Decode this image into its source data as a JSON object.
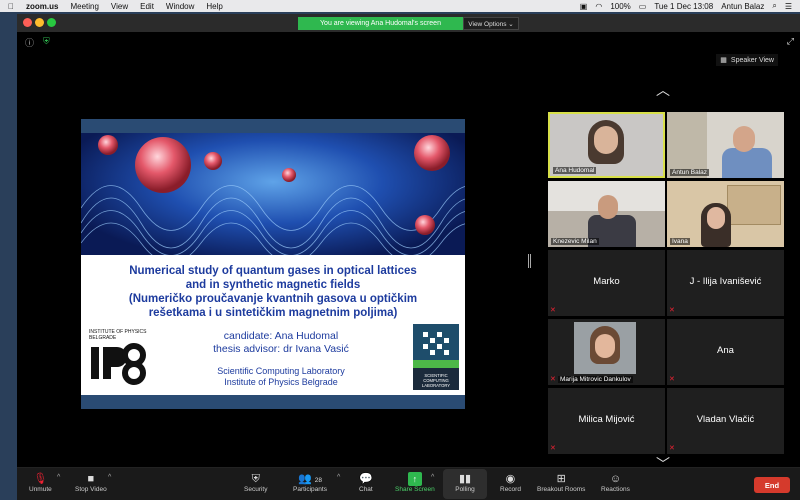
{
  "menubar": {
    "app": "zoom.us",
    "items": [
      "Meeting",
      "View",
      "Edit",
      "Window",
      "Help"
    ],
    "battery": "100%",
    "datetime": "Tue 1 Dec  13:08",
    "user": "Antun Balaz"
  },
  "banner": {
    "text": "You are viewing Ana Hudomal's screen",
    "view_options": "View Options ⌄"
  },
  "speaker_view": "Speaker View",
  "slide": {
    "title_lines": [
      "Numerical study of quantum gases in optical lattices",
      "and in synthetic magnetic fields",
      "(Numeričko proučavanje kvantnih gasova u optičkim",
      "rešetkama i u sintetičkim magnetnim poljima)"
    ],
    "candidate": "candidate: Ana Hudomal",
    "advisor": "thesis advisor: dr Ivana Vasić",
    "lab1": "Scientific Computing Laboratory",
    "lab2": "Institute of Physics Belgrade",
    "ipb_text": "INSTITUTE OF PHYSICS\nBELGRADE",
    "scl_text": "SCIENTIFIC\nCOMPUTING\nLABORATORY"
  },
  "participants": [
    {
      "name": "Ana Hudomal",
      "type": "video",
      "active": true
    },
    {
      "name": "Antun Balaz",
      "type": "video"
    },
    {
      "name": "Knezevic Milan",
      "type": "video"
    },
    {
      "name": "Ivana",
      "type": "video"
    },
    {
      "name": "Marko",
      "type": "name"
    },
    {
      "name": "J - Ilija Ivanišević",
      "type": "name"
    },
    {
      "name": "Marija Mitrovic Dankulov",
      "type": "photo"
    },
    {
      "name": "Ana",
      "type": "name"
    },
    {
      "name": "Milica Mijović",
      "type": "name"
    },
    {
      "name": "Vladan Vlačić",
      "type": "name"
    }
  ],
  "toolbar": {
    "unmute": "Unmute",
    "stop_video": "Stop Video",
    "security": "Security",
    "participants": "Participants",
    "participant_count": "28",
    "chat": "Chat",
    "share_screen": "Share Screen",
    "polling": "Polling",
    "record": "Record",
    "breakout": "Breakout Rooms",
    "reactions": "Reactions",
    "end": "End"
  },
  "colors": {
    "share_green": "#2fb84f",
    "end_red": "#d53a2c",
    "active_border": "#d8e04a"
  }
}
